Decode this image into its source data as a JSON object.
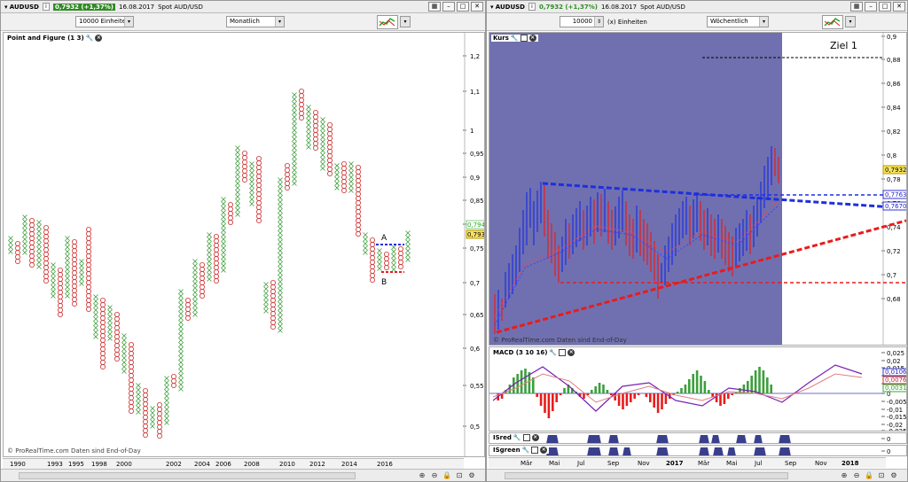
{
  "left": {
    "symbol": "AUDUSD",
    "price_badge": "0,7932 (+1,37%)",
    "date": "16.08.2017",
    "instrument": "Spot AUD/USD",
    "units_combo": "10000 Einheiten",
    "period_combo": "Monatlich",
    "panel_label": "Point and Figure (1 3)",
    "y_ticks": [
      "1,2",
      "1,1",
      "1",
      "0,95",
      "0,9",
      "0,85",
      "0,8",
      "0,75",
      "0,7",
      "0,65",
      "0,6",
      "0,55",
      "0,5"
    ],
    "price_tag_1": "0,7943",
    "price_tag_2": "0,7932",
    "label_a": "A",
    "label_b": "B",
    "x_ticks": [
      "1990",
      "1993",
      "1995",
      "1998",
      "2000",
      "2002",
      "2004",
      "2006",
      "2008",
      "2010",
      "2012",
      "2014",
      "2016"
    ],
    "footer": "© ProRealTime.com  Daten sind End-of-Day"
  },
  "right": {
    "symbol": "AUDUSD",
    "price_badge": "0,7932 (+1,37%)",
    "date": "16.08.2017",
    "instrument": "Spot AUD/USD",
    "units_value": "10000",
    "units_suffix": "(x) Einheiten",
    "period_combo": "Wöchentlich",
    "panel_label": "Kurs",
    "target_label": "Ziel 1",
    "y_ticks": [
      "0,9",
      "0,88",
      "0,86",
      "0,84",
      "0,82",
      "0,8",
      "0,78",
      "0,76",
      "0,74",
      "0,72",
      "0,7",
      "0,68"
    ],
    "price_tag": "0,7932",
    "line_tag_1": "0,7763",
    "line_tag_2": "0,7670",
    "footer": "© ProRealTime.com  Daten sind End-of-Day",
    "macd_label": "MACD (3 10 16)",
    "macd_ticks": [
      "0,025",
      "0,02",
      "0,015",
      "0,01",
      "0,005",
      "0",
      "-0,005",
      "-0,01",
      "-0,015",
      "-0,02",
      "-0,025"
    ],
    "macd_tags": [
      "0,0106",
      "0,0076",
      "0,0031"
    ],
    "isred_label": "ISred",
    "isgreen_label": "ISgreen",
    "is_tick": "0",
    "x_ticks": [
      "Mär",
      "Mai",
      "Jul",
      "Sep",
      "Nov",
      "2017",
      "Mär",
      "Mai",
      "Jul",
      "Sep",
      "Nov",
      "2018"
    ]
  },
  "colors": {
    "price_up": "#2e8b22",
    "kurs_bg": "#7070b0",
    "blue_line": "#1d2fe0",
    "red_line": "#e81c1c",
    "x_green": "#3c9f3c",
    "o_red": "#d03030"
  }
}
